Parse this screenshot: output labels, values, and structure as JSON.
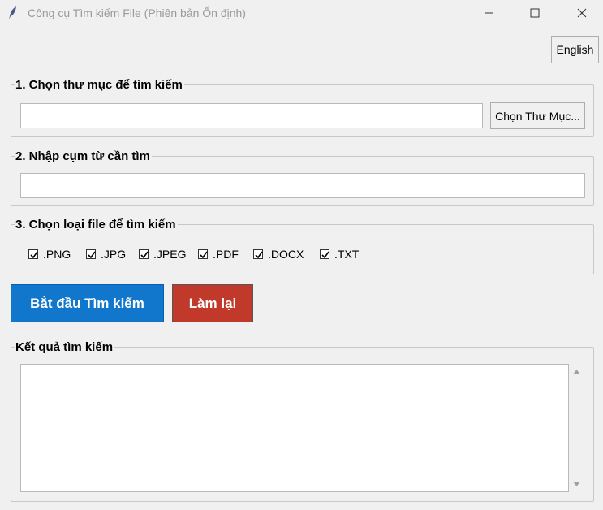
{
  "window": {
    "title": "Công cụ Tìm kiếm File (Phiên bản Ổn định)",
    "icon": "feather-icon",
    "controls": [
      "minimize-icon",
      "maximize-icon",
      "close-icon"
    ]
  },
  "language_button": "English",
  "folder_section": {
    "legend": "1. Chọn thư mục để tìm kiếm",
    "path_value": "",
    "browse_label": "Chọn Thư Mục..."
  },
  "phrase_section": {
    "legend": "2. Nhập cụm từ cần tìm",
    "phrase_value": ""
  },
  "filetype_section": {
    "legend": "3. Chọn loại file để tìm kiếm",
    "types": [
      {
        "label": ".PNG",
        "checked": true
      },
      {
        "label": ".JPG",
        "checked": true
      },
      {
        "label": ".JPEG",
        "checked": true
      },
      {
        "label": ".PDF",
        "checked": true
      },
      {
        "label": ".DOCX",
        "checked": true
      },
      {
        "label": ".TXT",
        "checked": true
      }
    ]
  },
  "actions": {
    "search_label": "Bắt đầu Tìm kiếm",
    "reset_label": "Làm lại"
  },
  "results_section": {
    "legend": "Kết quả tìm kiếm",
    "content": ""
  },
  "colors": {
    "search_button": "#1177cc",
    "reset_button": "#c0392b",
    "window_background": "#f0f0f0"
  }
}
